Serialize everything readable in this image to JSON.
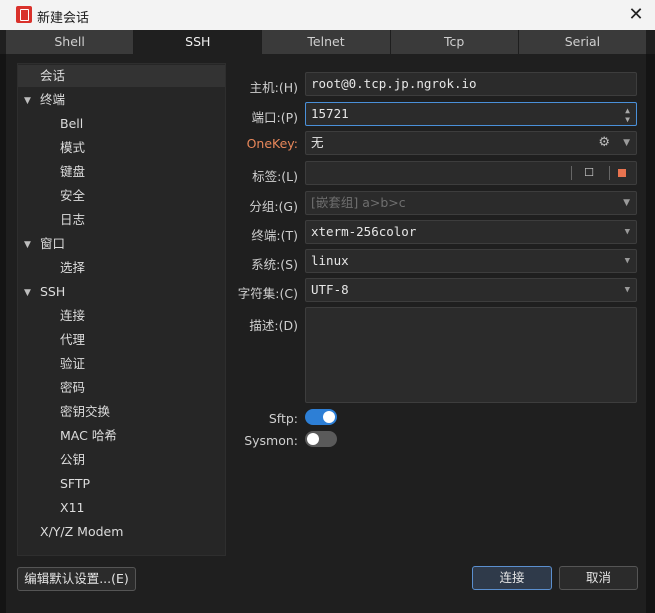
{
  "window": {
    "title": "新建会话",
    "close_glyph": "✕",
    "accent": "#d9312b"
  },
  "tabs": [
    {
      "label": "Shell",
      "active": false
    },
    {
      "label": "SSH",
      "active": true
    },
    {
      "label": "Telnet",
      "active": false
    },
    {
      "label": "Tcp",
      "active": false
    },
    {
      "label": "Serial",
      "active": false
    }
  ],
  "tree": {
    "session": "会话",
    "terminal": "终端",
    "terminal_items": [
      "Bell",
      "模式",
      "键盘",
      "安全",
      "日志"
    ],
    "window": "窗口",
    "window_items": [
      "选择"
    ],
    "ssh": "SSH",
    "ssh_items": [
      "连接",
      "代理",
      "验证",
      "密码",
      "密钥交换",
      "MAC 哈希",
      "公钥",
      "SFTP",
      "X11"
    ],
    "xyz": "X/Y/Z Modem",
    "expand_glyph": "▼"
  },
  "form": {
    "host_label": "主机:(H)",
    "host_value": "root@0.tcp.jp.ngrok.io",
    "port_label": "端口:(P)",
    "port_value": "15721",
    "onekey_label": "OneKey:",
    "onekey_value": "无",
    "tag_label": "标签:(L)",
    "tag_value": "",
    "group_label": "分组:(G)",
    "group_value": "[嵌套组] a>b>c",
    "terminal_label": "终端:(T)",
    "terminal_value": "xterm-256color",
    "system_label": "系统:(S)",
    "system_value": "linux",
    "charset_label": "字符集:(C)",
    "charset_value": "UTF-8",
    "desc_label": "描述:(D)",
    "desc_value": "",
    "sftp_label": "Sftp:",
    "sftp_on": true,
    "sysmon_label": "Sysmon:",
    "sysmon_on": false,
    "dropdown_glyph": "▼",
    "spin_up_glyph": "▲",
    "spin_down_glyph": "▼",
    "gear_glyph": "⚙",
    "edit_glyph": "☐",
    "color_swatch": "#e8734f"
  },
  "buttons": {
    "defaults": "编辑默认设置...(E)",
    "connect": "连接",
    "cancel": "取消"
  }
}
